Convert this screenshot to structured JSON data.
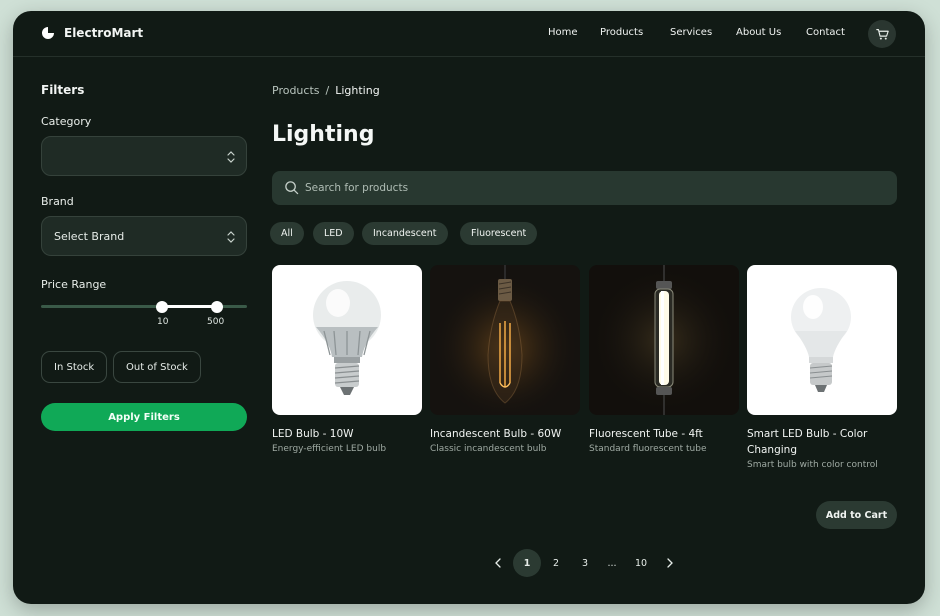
{
  "brand": {
    "name": "ElectroMart"
  },
  "nav": [
    "Home",
    "Products",
    "Services",
    "About Us",
    "Contact"
  ],
  "cart_icon": "shopping-cart-icon",
  "filters": {
    "title": "Filters",
    "category_label": "Category",
    "category_value": "",
    "brand_label": "Brand",
    "brand_value": "Select Brand",
    "price_label": "Price Range",
    "price_min": "10",
    "price_max": "500",
    "stock_options": [
      "In Stock",
      "Out of Stock"
    ],
    "apply_label": "Apply Filters"
  },
  "breadcrumb": {
    "root": "Products",
    "sep": "/",
    "current": "Lighting"
  },
  "page_title": "Lighting",
  "search": {
    "placeholder": "Search for products",
    "value": ""
  },
  "categories": [
    "All",
    "LED",
    "Incandescent",
    "Fluorescent"
  ],
  "products": [
    {
      "name": "LED Bulb - 10W",
      "desc": "Energy-efficient LED bulb"
    },
    {
      "name": "Incandescent Bulb - 60W",
      "desc": "Classic incandescent bulb"
    },
    {
      "name": "Fluorescent Tube - 4ft",
      "desc": "Standard fluorescent tube"
    },
    {
      "name": "Smart LED Bulb - Color Changing",
      "desc": "Smart bulb with color control"
    }
  ],
  "add_to_cart": "Add to Cart",
  "pagination": {
    "pages": [
      "1",
      "2",
      "3",
      "...",
      "10"
    ],
    "current": "1"
  },
  "colors": {
    "accent": "#10a957",
    "background": "#111a15",
    "surface": "#2b3a32"
  }
}
